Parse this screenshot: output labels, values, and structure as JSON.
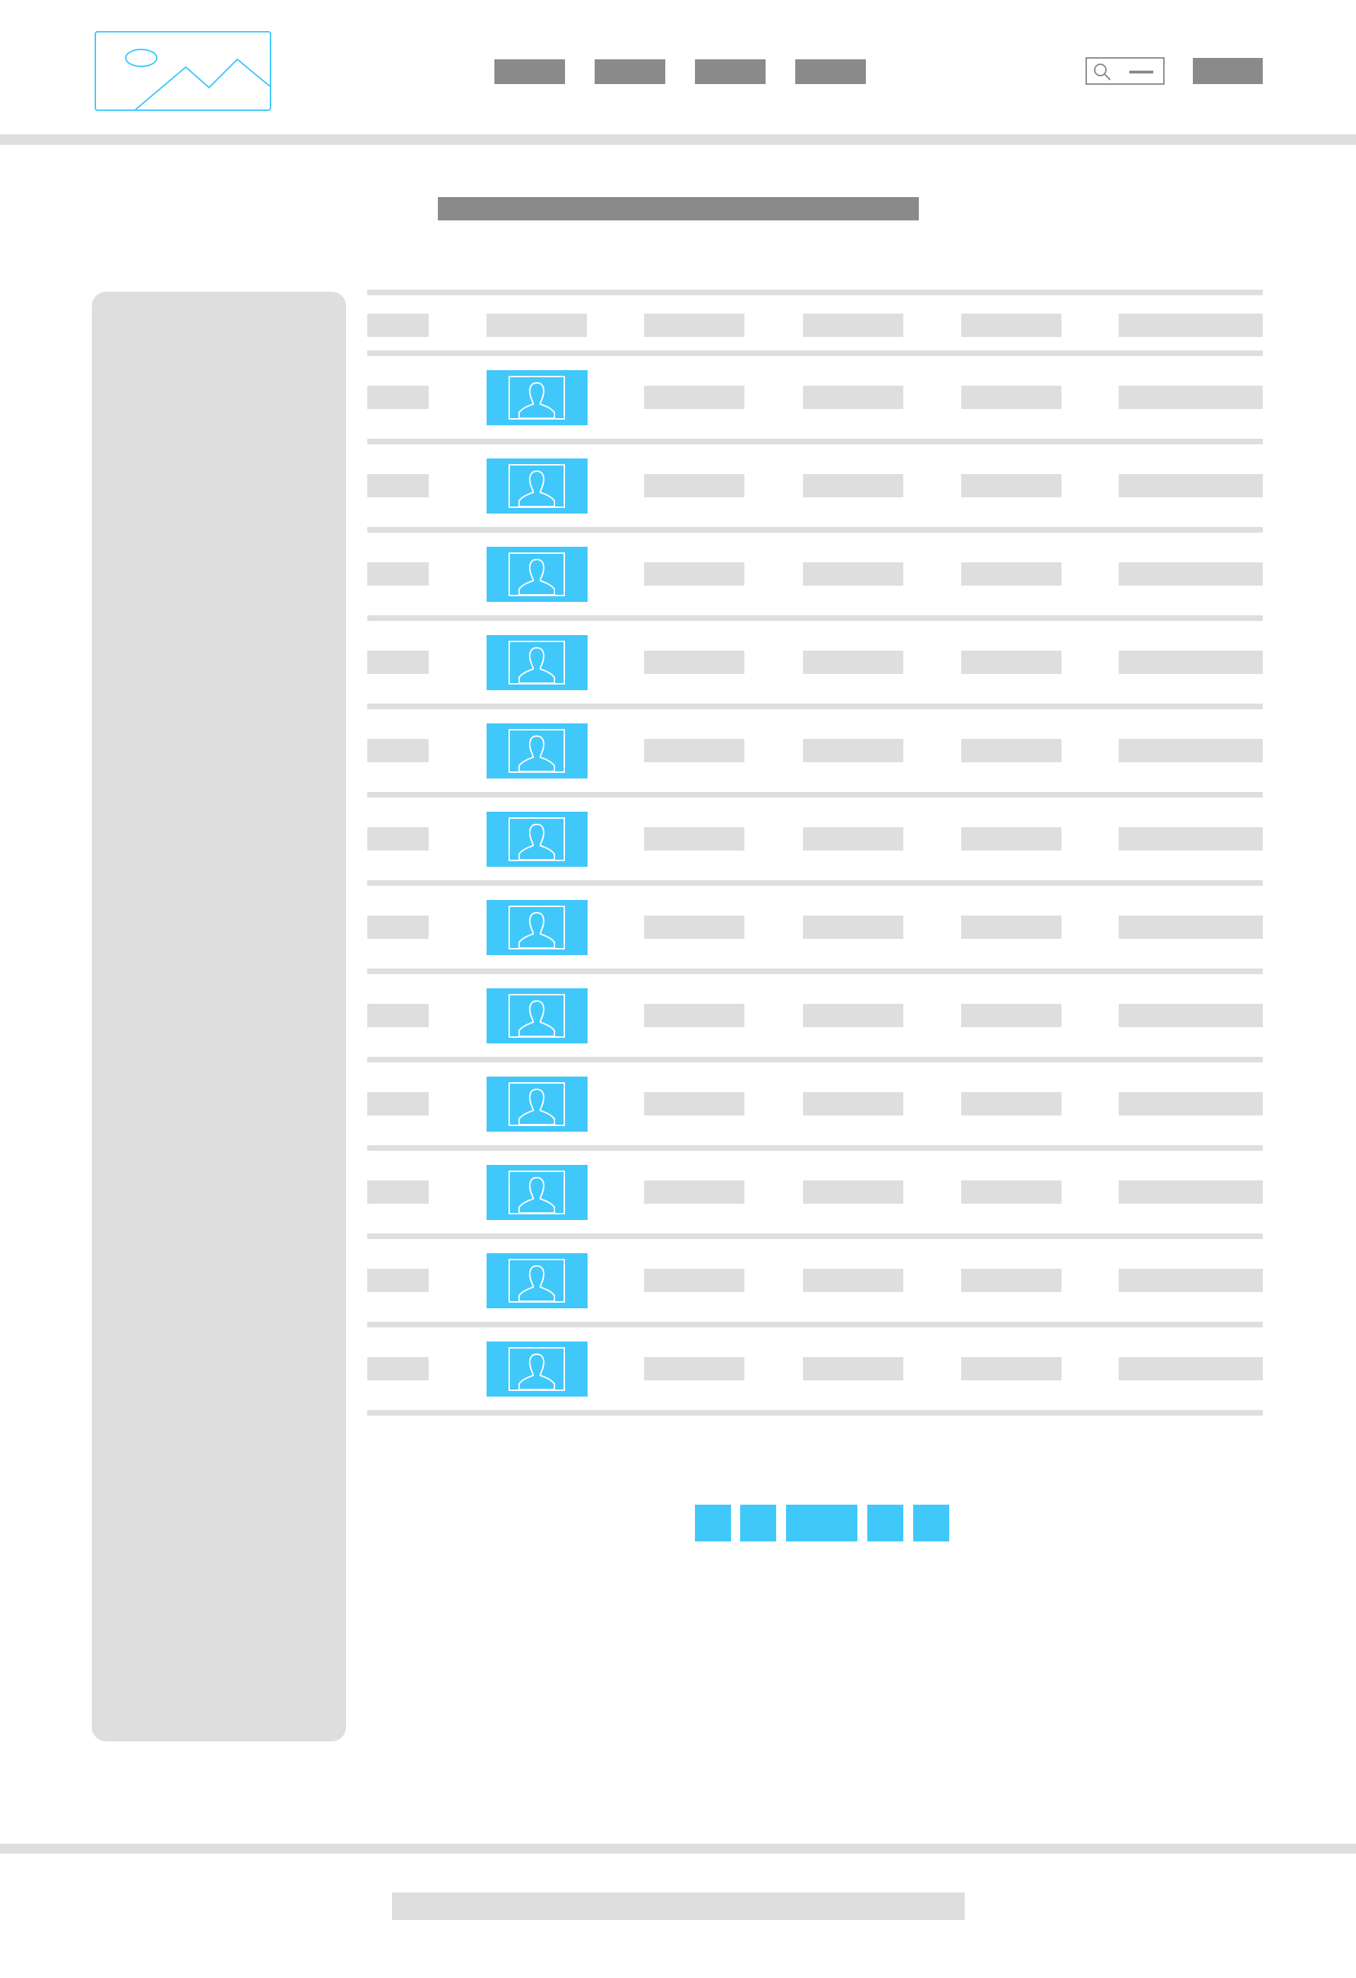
{
  "header": {
    "logo": {
      "icon": "image-placeholder-icon"
    },
    "nav": {
      "items": [
        "",
        "",
        "",
        ""
      ]
    },
    "search": {
      "icon": "search-icon",
      "placeholder": ""
    },
    "action_label": ""
  },
  "main": {
    "title": "",
    "table": {
      "columns": [
        "",
        "",
        "",
        "",
        "",
        ""
      ],
      "avatar_icon": "user-avatar-icon",
      "rows": 12
    },
    "pagination": {
      "pages": [
        "",
        "",
        "",
        "",
        ""
      ]
    }
  },
  "footer": {
    "text": ""
  },
  "colors": {
    "accent": "#40c8fb",
    "placeholder_dark": "#8a8a8a",
    "placeholder_light": "#dedede",
    "background": "#ffffff"
  }
}
